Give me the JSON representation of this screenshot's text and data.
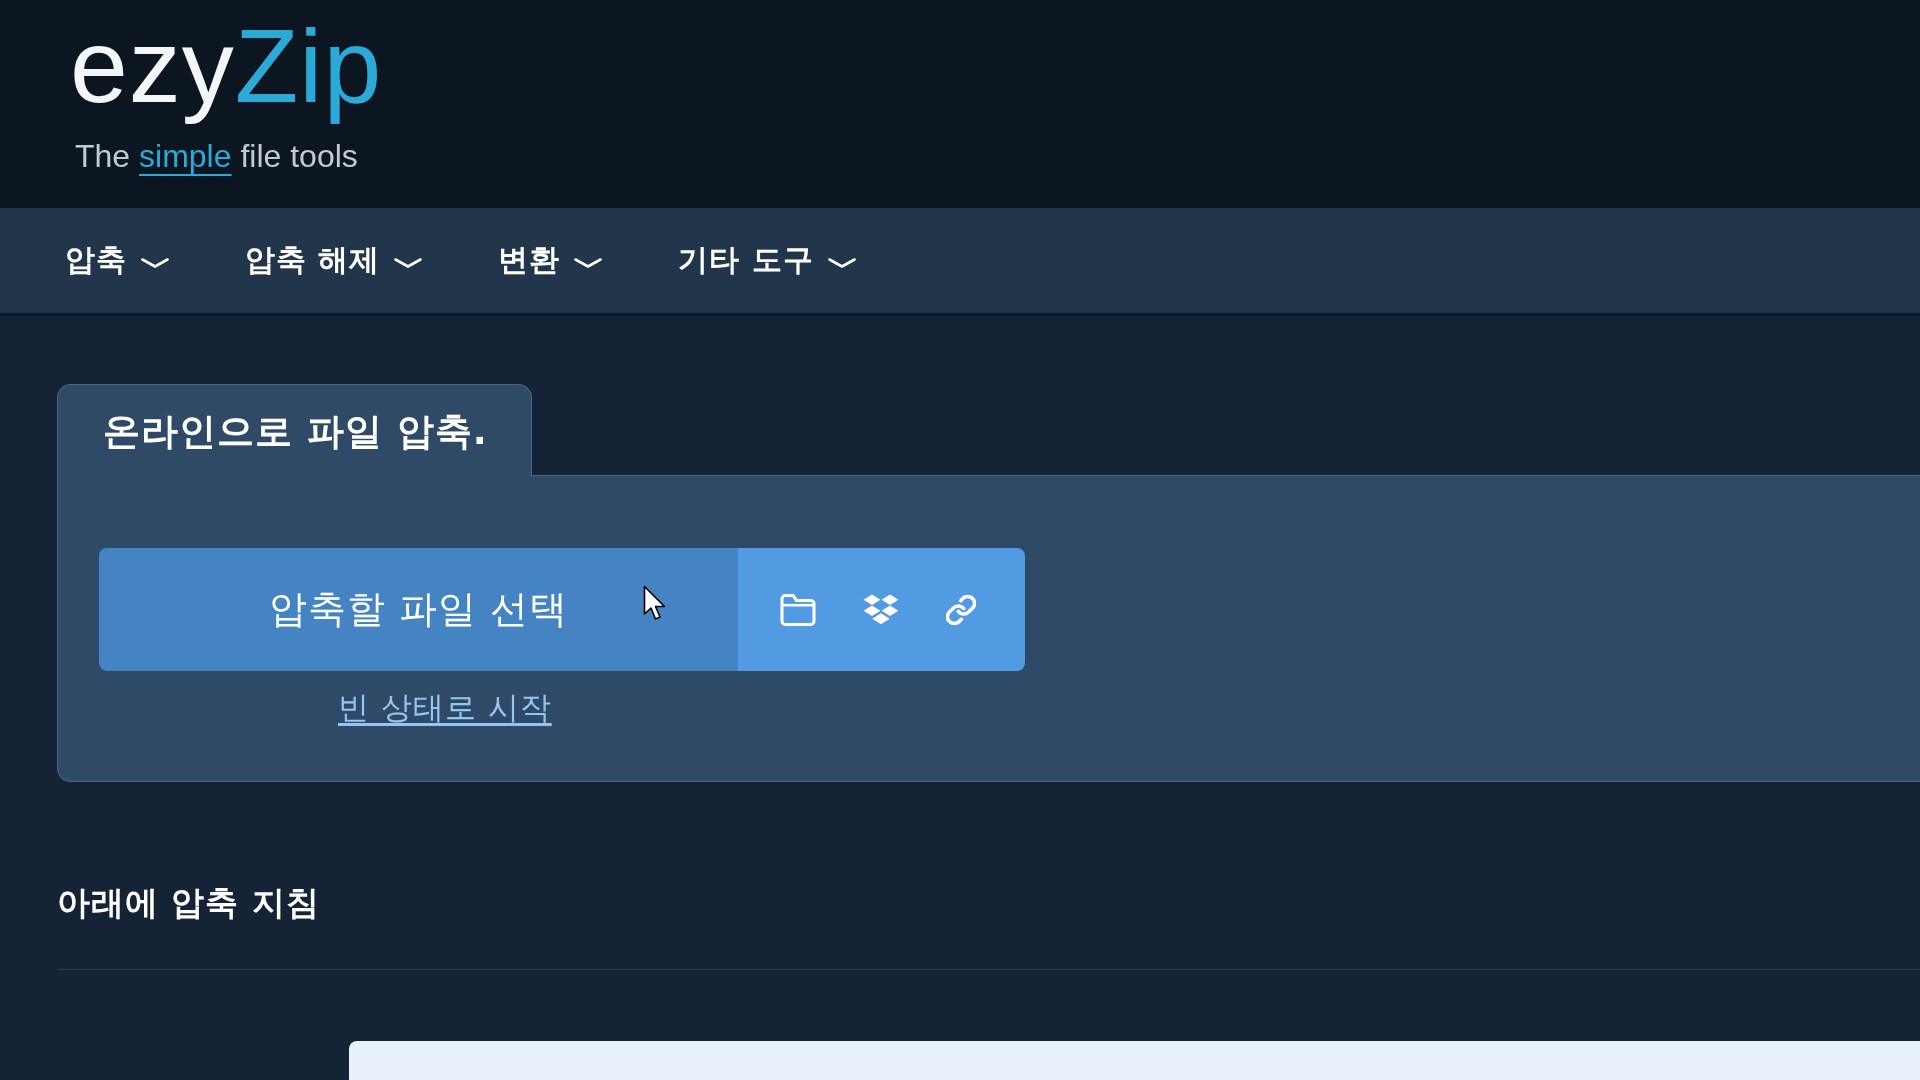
{
  "header": {
    "logo": {
      "wordmark_main": "ezy",
      "wordmark_accent": "Zip",
      "tagline_start": "The",
      "tagline_accent": "simple",
      "tagline_end": "file tools"
    }
  },
  "nav": {
    "items": [
      {
        "label": "압축"
      },
      {
        "label": "압축 해제"
      },
      {
        "label": "변환"
      },
      {
        "label": "기타 도구"
      }
    ]
  },
  "compress_card": {
    "tab_title": "온라인으로 파일 압축.",
    "choose_files_button": "압축할 파일 선택",
    "start_empty_link": "빈 상태로 시작"
  },
  "instructions": {
    "heading": "아래에 압축 지침"
  }
}
